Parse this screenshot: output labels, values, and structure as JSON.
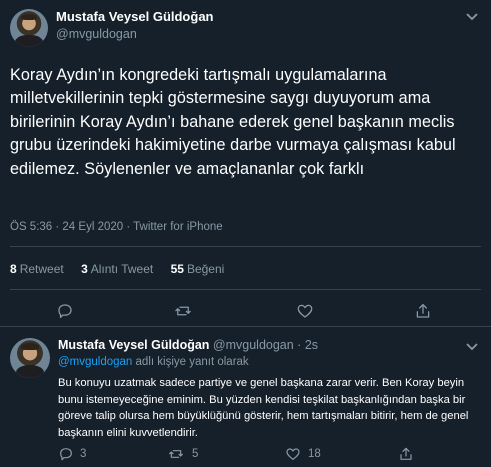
{
  "main_tweet": {
    "author_name": "Mustafa Veysel Güldoğan",
    "author_handle": "@mvguldogan",
    "text": "Koray Aydın’ın kongredeki tartışmalı uygulamalarına milletvekillerinin tepki göstermesine saygı duyuyorum ama birilerinin Koray Aydın’ı bahane ederek genel başkanın meclis grubu üzerindeki hakimiyetine darbe vurmaya çalışması kabul edilemez. Söylenenler ve amaçlananlar çok farklı",
    "meta": "ÖS 5:36 · 24 Eyl 2020 · Twitter for iPhone",
    "stats": {
      "retweets_count": "8",
      "retweets_label": "Retweet",
      "quotes_count": "3",
      "quotes_label": "Alıntı Tweet",
      "likes_count": "55",
      "likes_label": "Beğeni"
    }
  },
  "reply_tweet": {
    "author_name": "Mustafa Veysel Güldoğan",
    "author_handle": "@mvguldogan · 2s",
    "replying_mention": "@mvguldogan",
    "replying_suffix": " adlı kişiye yanıt olarak",
    "text": "Bu konuyu uzatmak sadece partiye ve genel başkana zarar verir. Ben Koray beyin bunu istemeyeceğine eminim. Bu yüzden kendisi teşkilat başkanlığından başka bir göreve talip olursa hem büyüklüğünü gösterir, hem tartışmaları bitirir, hem de genel başkanın elini kuvvetlendirir.",
    "reply_count": "3",
    "retweet_count": "5",
    "like_count": "18"
  },
  "icons": {
    "reply": "reply-icon",
    "retweet": "retweet-icon",
    "like": "heart-icon",
    "share": "share-icon",
    "more": "chevron-down-icon"
  },
  "colors": {
    "background": "#15202b",
    "text": "#ffffff",
    "secondary": "#8899a6",
    "accent": "#1da1f2",
    "border": "#38444d"
  }
}
